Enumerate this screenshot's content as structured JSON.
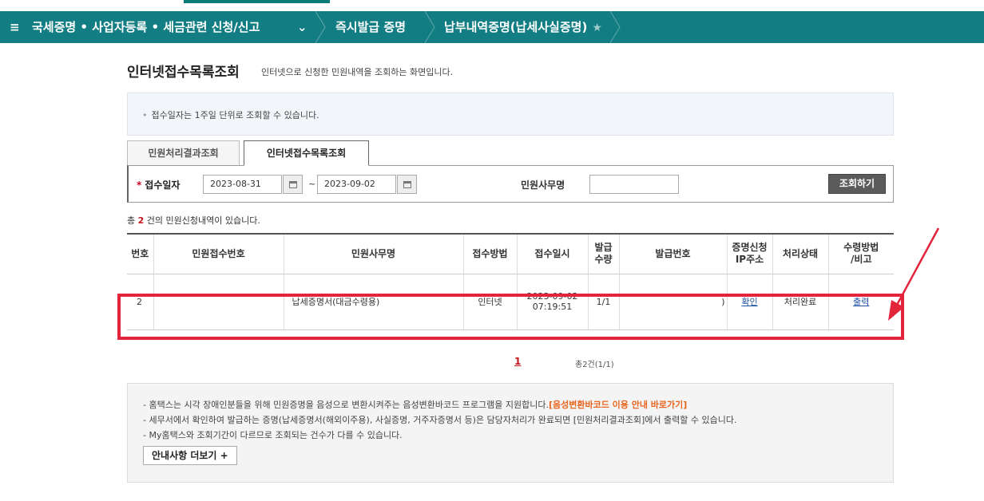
{
  "nav": {
    "menu": "국세증명 • 사업자등록 • 세금관련 신청/신고",
    "crumb1": "즉시발급 증명",
    "crumb2": "납부내역증명(납세사실증명)"
  },
  "page": {
    "title": "인터넷접수목록조회",
    "subtitle": "인터넷으로 신청한 민원내역을 조회하는 화면입니다.",
    "notice": "접수일자는 1주일 단위로 조회할 수 있습니다."
  },
  "tabs": [
    "민원처리결과조회",
    "인터넷접수목록조회"
  ],
  "search": {
    "date_label": "접수일자",
    "from": "2023-08-31",
    "to": "2023-09-02",
    "tilde": "~",
    "service_label": "민원사무명",
    "button": "조회하기"
  },
  "total": {
    "prefix": "총 ",
    "count": "2",
    "suffix": " 건의 민원신청내역이 있습니다."
  },
  "table": {
    "headers": [
      "번호",
      "민원접수번호",
      "민원사무명",
      "접수방법",
      "접수일시",
      "발급\n수량",
      "발급번호",
      "증명신청\nIP주소",
      "처리상태",
      "수령방법\n/비고"
    ],
    "row": {
      "no": "2",
      "receipt_no": "",
      "service": "납세증명서(대금수령용)",
      "method": "인터넷",
      "date": "2023-09-02",
      "time": "07:19:51",
      "qty": "1/1",
      "issue_no": ")",
      "ip": "확인",
      "status": "처리완료",
      "receive": "출력"
    }
  },
  "pager": {
    "page": "1",
    "info": "총2건(1/1)"
  },
  "guide": {
    "line1": "- 홈택스는 시각 장애인분들을 위해 민원증명을 음성으로 변환시켜주는 음성변환바코드 프로그램을 지원합니다.",
    "line1_link": "[음성변환바코드 이용 안내 바로가기]",
    "line2": "- 세무서에서 확인하여 발급하는 증명(납세증명서(해외이주용), 사실증명, 거주자증명서 등)은 담당자처리가 완료되면 [민원처리결과조회]에서 출력할 수 있습니다.",
    "line3": "- My홈택스와 조회기간이 다르므로 조회되는 건수가 다를 수 있습니다.",
    "more": "안내사항 더보기  +"
  },
  "colors": {
    "nav": "#127d82",
    "highlight": "#e3243b"
  }
}
